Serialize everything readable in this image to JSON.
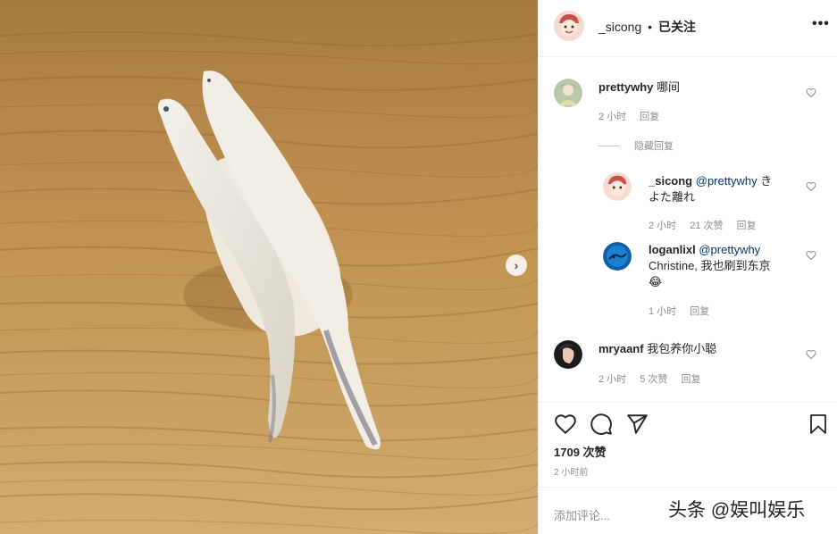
{
  "header": {
    "username": "_sicong",
    "separator": "•",
    "follow_status": "已关注",
    "more_icon": "more-icon"
  },
  "comments": [
    {
      "username": "prettywhy",
      "text": "哪间",
      "time": "2 小时",
      "reply": "回复"
    }
  ],
  "hidden_replies": "隐藏回复",
  "replies": [
    {
      "username": "_sicong",
      "mention": "@prettywhy",
      "text_line1": "き",
      "text_line2": "よた離れ",
      "time": "2 小时",
      "likes": "21 次赞",
      "reply": "回复"
    },
    {
      "username": "loganlixl",
      "mention": "@prettywhy",
      "text_line1": "Christine, 我也刷到东京",
      "emoji": "😂",
      "time": "1 小时",
      "reply": "回复"
    }
  ],
  "comment3": {
    "username": "mryaanf",
    "text": "我包养你小聪",
    "time": "2 小时",
    "likes": "5 次赞",
    "reply": "回复"
  },
  "post": {
    "likes": "1709 次赞",
    "time": "2 小时前",
    "add_comment_placeholder": "添加评论..."
  },
  "watermark": "头条 @娱叫娱乐",
  "colors": {
    "mention": "#00376b",
    "muted": "#8e8e8e",
    "text": "#262626"
  }
}
